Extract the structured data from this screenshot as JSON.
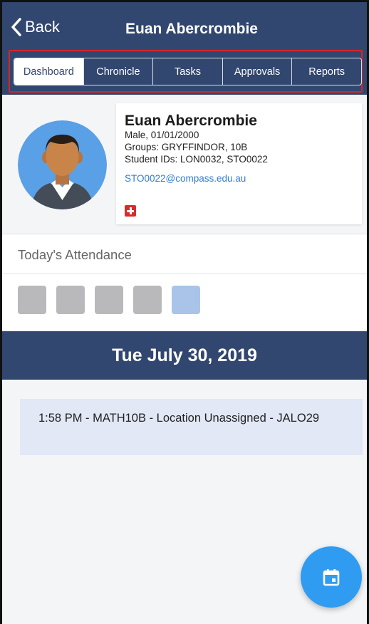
{
  "header": {
    "back_label": "Back",
    "title": "Euan Abercrombie"
  },
  "tabs": [
    {
      "label": "Dashboard",
      "active": true
    },
    {
      "label": "Chronicle",
      "active": false
    },
    {
      "label": "Tasks",
      "active": false
    },
    {
      "label": "Approvals",
      "active": false
    },
    {
      "label": "Reports",
      "active": false
    }
  ],
  "profile": {
    "name": "Euan Abercrombie",
    "gender_dob": "Male, 01/01/2000",
    "groups": "Groups: GRYFFINDOR, 10B",
    "student_ids": "Student IDs: LON0032, STO0022",
    "email": "STO0022@compass.edu.au",
    "medical_icon": "medical-cross-icon"
  },
  "attendance": {
    "label": "Today's Attendance",
    "blocks": [
      "grey",
      "grey",
      "grey",
      "grey",
      "light-blue"
    ]
  },
  "date_bar": {
    "date": "Tue July 30, 2019"
  },
  "events": [
    {
      "text": "1:58 PM - MATH10B - Location Unassigned - JALO29"
    }
  ],
  "fab": {
    "icon": "calendar-icon"
  },
  "colors": {
    "header": "#32476f",
    "tab_highlight_border": "#d2262a",
    "event_bg": "#e2e8f6",
    "fab": "#2f9cf2",
    "link": "#2f7dd6",
    "medical": "#d92b2b"
  }
}
